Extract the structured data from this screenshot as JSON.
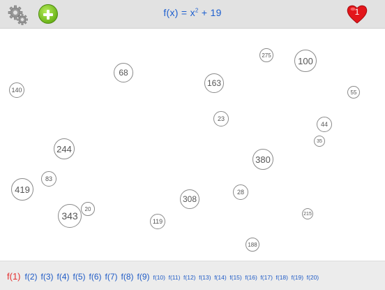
{
  "header": {
    "title": "f(x) = x",
    "title_exp": "2",
    "title_rest": " + 19",
    "lives": "1",
    "icons": [
      "gear-icon",
      "plus-icon",
      "heart-icon"
    ],
    "colors": {
      "title": "#1d5fcf",
      "heart": "#e3161b",
      "plus": "#6db51b"
    }
  },
  "bubbles": [
    "140",
    "68",
    "163",
    "275",
    "100",
    "55",
    "23",
    "44",
    "35",
    "244",
    "380",
    "83",
    "419",
    "28",
    "308",
    "20",
    "343",
    "119",
    "215",
    "188"
  ],
  "functions": {
    "active_index": 0,
    "items": [
      "f(1)",
      "f(2)",
      "f(3)",
      "f(4)",
      "f(5)",
      "f(6)",
      "f(7)",
      "f(8)",
      "f(9)",
      "f(10)",
      "f(11)",
      "f(12)",
      "f(13)",
      "f(14)",
      "f(15)",
      "f(16)",
      "f(17)",
      "f(18)",
      "f(19)",
      "f(20)"
    ],
    "colors": {
      "active": "#e53030",
      "inactive": "#1f5bc6"
    }
  }
}
